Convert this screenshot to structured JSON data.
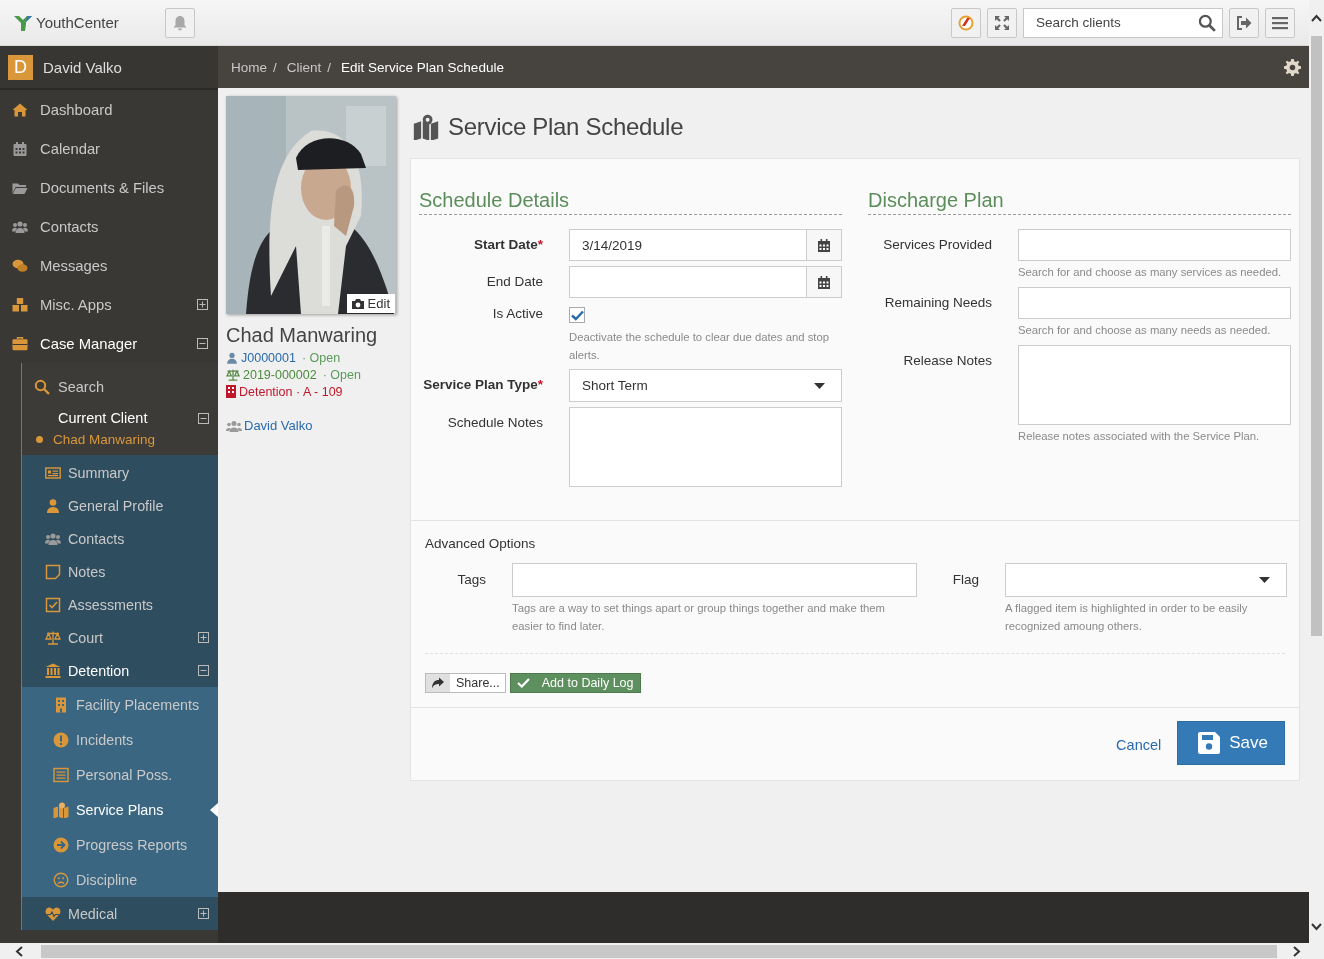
{
  "app": {
    "name": "YouthCenter"
  },
  "topbar": {
    "search": {
      "placeholder": "Search clients"
    }
  },
  "user": {
    "initial": "D",
    "name": "David Valko"
  },
  "sidebar": {
    "items": [
      {
        "label": "Dashboard"
      },
      {
        "label": "Calendar"
      },
      {
        "label": "Documents & Files"
      },
      {
        "label": "Contacts"
      },
      {
        "label": "Messages"
      },
      {
        "label": "Misc. Apps",
        "expanded": false
      },
      {
        "label": "Case Manager",
        "expanded": true,
        "children": [
          {
            "label": "Search"
          },
          {
            "label": "Current Client",
            "expanded": true,
            "client": "Chad Manwaring",
            "children": [
              {
                "label": "Summary"
              },
              {
                "label": "General Profile"
              },
              {
                "label": "Contacts"
              },
              {
                "label": "Notes"
              },
              {
                "label": "Assessments"
              },
              {
                "label": "Court",
                "expanded": false
              },
              {
                "label": "Detention",
                "expanded": true,
                "children": [
                  {
                    "label": "Facility Placements",
                    "selected": false
                  },
                  {
                    "label": "Incidents",
                    "selected": false
                  },
                  {
                    "label": "Personal Poss.",
                    "selected": false
                  },
                  {
                    "label": "Service Plans",
                    "selected": true
                  },
                  {
                    "label": "Progress Reports",
                    "selected": false
                  },
                  {
                    "label": "Discipline",
                    "selected": false
                  }
                ]
              },
              {
                "label": "Medical",
                "expanded": false
              }
            ]
          }
        ]
      }
    ]
  },
  "breadcrumb": [
    {
      "label": "Home",
      "separator": "/"
    },
    {
      "label": "Client",
      "separator": "/"
    },
    {
      "label": "Edit Service Plan Schedule"
    }
  ],
  "client": {
    "name": "Chad Manwaring",
    "edit_label": "Edit",
    "details": [
      {
        "kind": "juvenile",
        "number": "J0000001",
        "status": "· Open"
      },
      {
        "kind": "case",
        "number": "2019-000002",
        "status": "· Open"
      },
      {
        "kind": "placement",
        "number": "Detention · A - 109"
      }
    ],
    "worker": "David Valko"
  },
  "page_title": "Service Plan Schedule",
  "schedule_details": {
    "title": "Schedule Details",
    "fields": [
      {
        "kind": "date",
        "label": "Start Date",
        "required_mark": "*",
        "value": "3/14/2019"
      },
      {
        "kind": "date",
        "label": "End Date"
      },
      {
        "kind": "checkbox",
        "label": "Is Active",
        "checked": true,
        "help": "Deactivate the schedule to clear due dates and stop alerts."
      },
      {
        "kind": "select",
        "label": "Service Plan Type",
        "required_mark": "*",
        "value": "Short Term"
      },
      {
        "kind": "textarea",
        "label": "Schedule Notes"
      }
    ]
  },
  "discharge_plan": {
    "title": "Discharge Plan",
    "fields": [
      {
        "kind": "multi",
        "label": "Services Provided",
        "help": "Search for and choose as many services as needed."
      },
      {
        "kind": "multi",
        "label": "Remaining Needs",
        "help": "Search for and choose as many needs as needed."
      },
      {
        "kind": "textarea",
        "label": "Release Notes",
        "help": "Release notes associated with the Service Plan."
      }
    ]
  },
  "advanced_options": {
    "title": "Advanced Options",
    "fields": [
      {
        "kind": "multi",
        "label": "Tags",
        "help": "Tags are a way to set things apart or group things together and make them easier to find later."
      },
      {
        "kind": "select",
        "label": "Flag",
        "help": "A flagged item is highlighted in order to be easily recognized amoung others."
      }
    ]
  },
  "actions": {
    "share": "Share...",
    "daily_log": "Add to Daily Log",
    "cancel": "Cancel",
    "save": "Save"
  }
}
